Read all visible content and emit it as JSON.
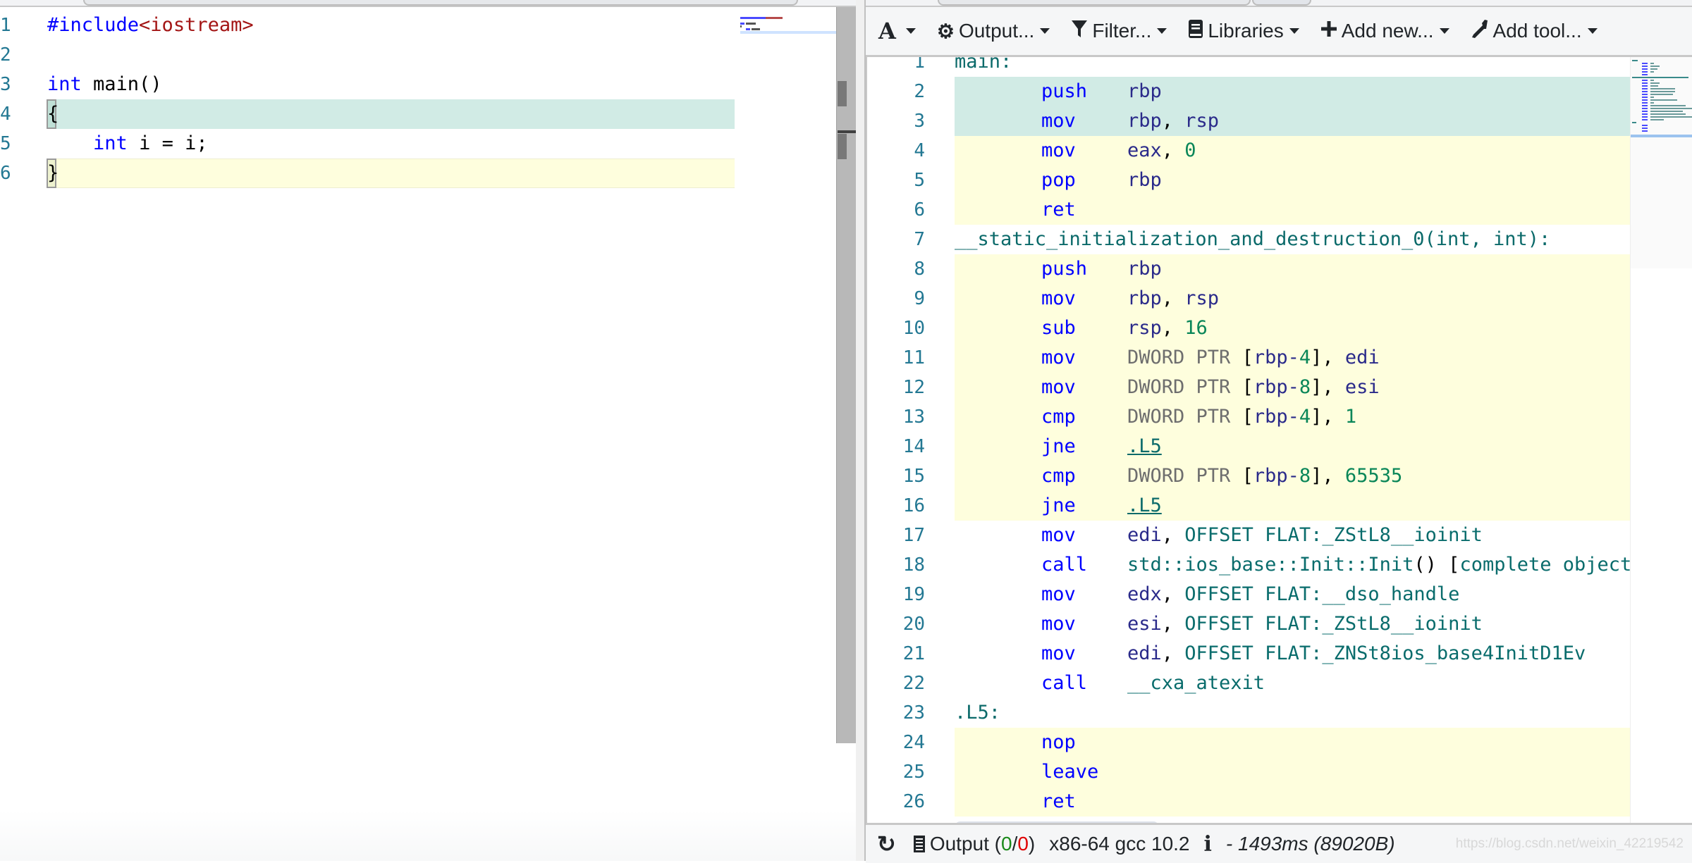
{
  "source_editor": {
    "lines": [
      {
        "number": "1",
        "tokens": [
          {
            "t": "#include",
            "c": "inc"
          },
          {
            "t": "<iostream>",
            "c": "str"
          }
        ],
        "highlight": "none"
      },
      {
        "number": "2",
        "tokens": [],
        "highlight": "none"
      },
      {
        "number": "3",
        "tokens": [
          {
            "t": "int",
            "c": "kw"
          },
          {
            "t": " main()",
            "c": ""
          }
        ],
        "highlight": "none"
      },
      {
        "number": "4",
        "tokens": [
          {
            "t": "{",
            "c": ""
          }
        ],
        "highlight": "green"
      },
      {
        "number": "5",
        "tokens": [
          {
            "t": "    ",
            "c": ""
          },
          {
            "t": "int",
            "c": "kw"
          },
          {
            "t": " i = i;",
            "c": ""
          }
        ],
        "highlight": "none"
      },
      {
        "number": "6",
        "tokens": [
          {
            "t": "}",
            "c": ""
          }
        ],
        "highlight": "yellow"
      }
    ]
  },
  "toolbar": {
    "font_button": {
      "icon": "font-icon",
      "glyph": "A"
    },
    "output_button": {
      "icon": "gear-icon",
      "label": "Output..."
    },
    "filter_button": {
      "icon": "filter-icon",
      "label": "Filter..."
    },
    "libraries_button": {
      "icon": "book-icon",
      "label": "Libraries"
    },
    "add_new_button": {
      "icon": "plus-icon",
      "label": "Add new..."
    },
    "add_tool_button": {
      "icon": "wrench-icon",
      "label": "Add tool..."
    }
  },
  "assembly": {
    "lines": [
      {
        "n": "1",
        "label": "main:",
        "hl": "none"
      },
      {
        "n": "2",
        "mn": "push",
        "ops": [
          {
            "t": "rbp",
            "c": "reg"
          }
        ],
        "hl": "g"
      },
      {
        "n": "3",
        "mn": "mov",
        "ops": [
          {
            "t": "rbp",
            "c": "reg"
          },
          {
            "t": ", ",
            "c": "pun"
          },
          {
            "t": "rsp",
            "c": "reg"
          }
        ],
        "hl": "g"
      },
      {
        "n": "4",
        "mn": "mov",
        "ops": [
          {
            "t": "eax",
            "c": "reg"
          },
          {
            "t": ", ",
            "c": "pun"
          },
          {
            "t": "0",
            "c": "num"
          }
        ],
        "hl": "y"
      },
      {
        "n": "5",
        "mn": "pop",
        "ops": [
          {
            "t": "rbp",
            "c": "reg"
          }
        ],
        "hl": "y"
      },
      {
        "n": "6",
        "mn": "ret",
        "ops": [],
        "hl": "y"
      },
      {
        "n": "7",
        "label": "__static_initialization_and_destruction_0(int, int):",
        "hl": "none"
      },
      {
        "n": "8",
        "mn": "push",
        "ops": [
          {
            "t": "rbp",
            "c": "reg"
          }
        ],
        "hl": "y"
      },
      {
        "n": "9",
        "mn": "mov",
        "ops": [
          {
            "t": "rbp",
            "c": "reg"
          },
          {
            "t": ", ",
            "c": "pun"
          },
          {
            "t": "rsp",
            "c": "reg"
          }
        ],
        "hl": "y"
      },
      {
        "n": "10",
        "mn": "sub",
        "ops": [
          {
            "t": "rsp",
            "c": "reg"
          },
          {
            "t": ", ",
            "c": "pun"
          },
          {
            "t": "16",
            "c": "num"
          }
        ],
        "hl": "y"
      },
      {
        "n": "11",
        "mn": "mov",
        "ops": [
          {
            "t": "DWORD PTR ",
            "c": "ptr"
          },
          {
            "t": "[",
            "c": "pun"
          },
          {
            "t": "rbp",
            "c": "reg"
          },
          {
            "t": "-",
            "c": "reg"
          },
          {
            "t": "4",
            "c": "num"
          },
          {
            "t": "]",
            "c": "pun"
          },
          {
            "t": ", ",
            "c": "pun"
          },
          {
            "t": "edi",
            "c": "reg"
          }
        ],
        "hl": "y"
      },
      {
        "n": "12",
        "mn": "mov",
        "ops": [
          {
            "t": "DWORD PTR ",
            "c": "ptr"
          },
          {
            "t": "[",
            "c": "pun"
          },
          {
            "t": "rbp",
            "c": "reg"
          },
          {
            "t": "-",
            "c": "reg"
          },
          {
            "t": "8",
            "c": "num"
          },
          {
            "t": "]",
            "c": "pun"
          },
          {
            "t": ", ",
            "c": "pun"
          },
          {
            "t": "esi",
            "c": "reg"
          }
        ],
        "hl": "y"
      },
      {
        "n": "13",
        "mn": "cmp",
        "ops": [
          {
            "t": "DWORD PTR ",
            "c": "ptr"
          },
          {
            "t": "[",
            "c": "pun"
          },
          {
            "t": "rbp",
            "c": "reg"
          },
          {
            "t": "-",
            "c": "reg"
          },
          {
            "t": "4",
            "c": "num"
          },
          {
            "t": "]",
            "c": "pun"
          },
          {
            "t": ", ",
            "c": "pun"
          },
          {
            "t": "1",
            "c": "num"
          }
        ],
        "hl": "y"
      },
      {
        "n": "14",
        "mn": "jne",
        "ops": [
          {
            "t": ".L5",
            "c": "lnk"
          }
        ],
        "hl": "y"
      },
      {
        "n": "15",
        "mn": "cmp",
        "ops": [
          {
            "t": "DWORD PTR ",
            "c": "ptr"
          },
          {
            "t": "[",
            "c": "pun"
          },
          {
            "t": "rbp",
            "c": "reg"
          },
          {
            "t": "-",
            "c": "reg"
          },
          {
            "t": "8",
            "c": "num"
          },
          {
            "t": "]",
            "c": "pun"
          },
          {
            "t": ", ",
            "c": "pun"
          },
          {
            "t": "65535",
            "c": "num"
          }
        ],
        "hl": "y"
      },
      {
        "n": "16",
        "mn": "jne",
        "ops": [
          {
            "t": ".L5",
            "c": "lnk"
          }
        ],
        "hl": "y"
      },
      {
        "n": "17",
        "mn": "mov",
        "ops": [
          {
            "t": "edi",
            "c": "reg"
          },
          {
            "t": ", ",
            "c": "pun"
          },
          {
            "t": "OFFSET FLAT:_ZStL8__ioinit",
            "c": ""
          }
        ],
        "hl": "none"
      },
      {
        "n": "18",
        "mn": "call",
        "ops": [
          {
            "t": "std::ios_base::Init::Init",
            "c": ""
          },
          {
            "t": "()",
            "c": "pun"
          },
          {
            "t": " ",
            "c": ""
          },
          {
            "t": "[",
            "c": "pun"
          },
          {
            "t": "complete object constructor]",
            "c": ""
          }
        ],
        "hl": "none"
      },
      {
        "n": "19",
        "mn": "mov",
        "ops": [
          {
            "t": "edx",
            "c": "reg"
          },
          {
            "t": ", ",
            "c": "pun"
          },
          {
            "t": "OFFSET FLAT:__dso_handle",
            "c": ""
          }
        ],
        "hl": "none"
      },
      {
        "n": "20",
        "mn": "mov",
        "ops": [
          {
            "t": "esi",
            "c": "reg"
          },
          {
            "t": ", ",
            "c": "pun"
          },
          {
            "t": "OFFSET FLAT:_ZStL8__ioinit",
            "c": ""
          }
        ],
        "hl": "none"
      },
      {
        "n": "21",
        "mn": "mov",
        "ops": [
          {
            "t": "edi",
            "c": "reg"
          },
          {
            "t": ", ",
            "c": "pun"
          },
          {
            "t": "OFFSET FLAT:_ZNSt8ios_base4InitD1Ev",
            "c": ""
          }
        ],
        "hl": "none"
      },
      {
        "n": "22",
        "mn": "call",
        "ops": [
          {
            "t": "__cxa_atexit",
            "c": ""
          }
        ],
        "hl": "none"
      },
      {
        "n": "23",
        "label": ".L5:",
        "hl": "none"
      },
      {
        "n": "24",
        "mn": "nop",
        "ops": [],
        "hl": "y"
      },
      {
        "n": "25",
        "mn": "leave",
        "ops": [],
        "hl": "y"
      },
      {
        "n": "26",
        "mn": "ret",
        "ops": [],
        "hl": "y"
      }
    ]
  },
  "statusbar": {
    "refresh_icon": "refresh-icon",
    "output_icon": "output-icon",
    "output_label": "Output (",
    "output_ok": "0",
    "output_sep": "/",
    "output_err": "0",
    "output_close": ")",
    "compiler": "x86-64 gcc 10.2",
    "info_icon": "info-icon",
    "timing": "- 1493ms (89020B)",
    "watermark": "https://blog.csdn.net/weixin_42219542"
  },
  "colors": {
    "highlight_green": "#d1ebe5",
    "highlight_yellow": "#fefedd",
    "line_number": "#237893",
    "keyword": "#0000ff",
    "string": "#a31515"
  }
}
